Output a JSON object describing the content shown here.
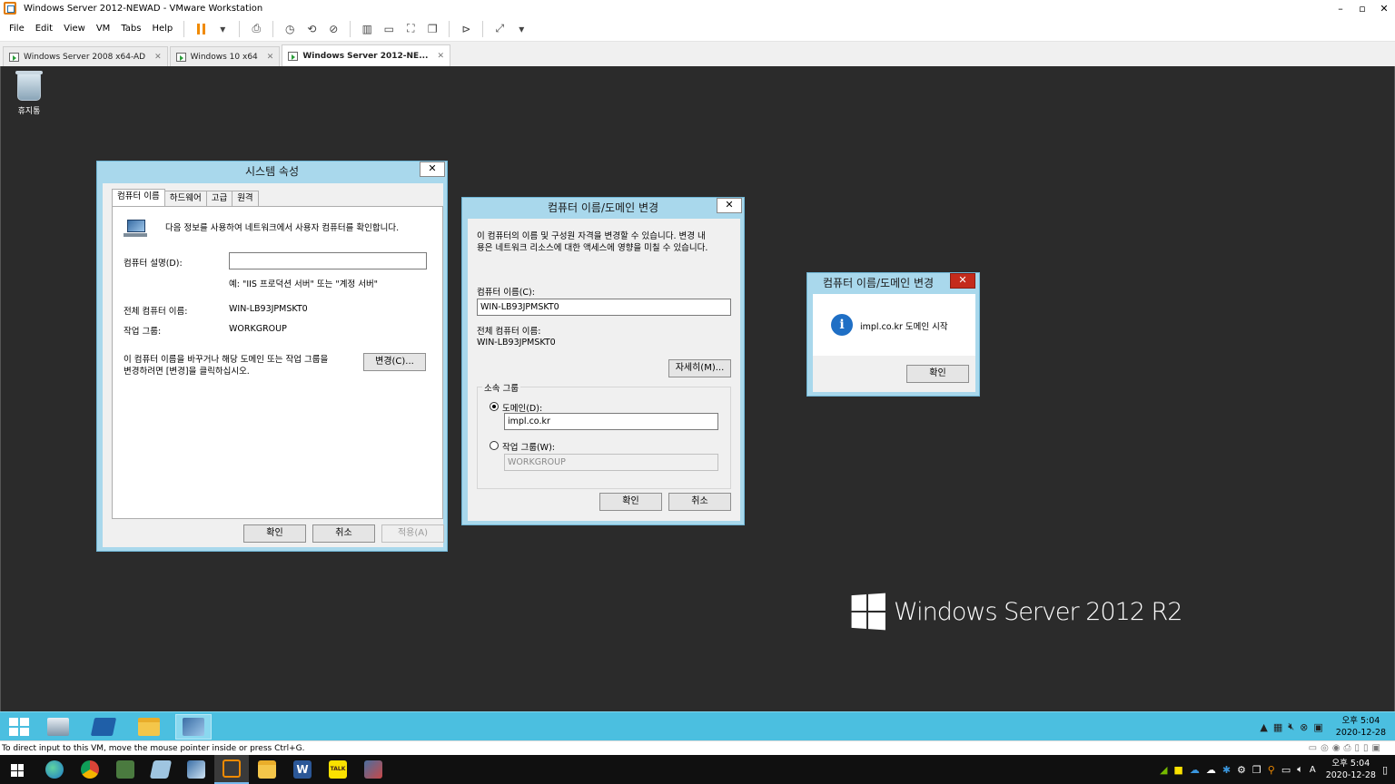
{
  "window": {
    "title": "Windows Server 2012-NEWAD - VMware Workstation",
    "controls": [
      "–",
      "▫",
      "✕"
    ]
  },
  "menu": {
    "items": [
      "File",
      "Edit",
      "View",
      "VM",
      "Tabs",
      "Help"
    ]
  },
  "vm_tabs": [
    {
      "label": "Windows Server 2008 x64-AD",
      "active": false
    },
    {
      "label": "Windows 10 x64",
      "active": false
    },
    {
      "label": "Windows Server 2012-NE...",
      "active": true
    }
  ],
  "desktop": {
    "recycle_bin_label": "휴지통",
    "branding": "Windows Server 2012 R2"
  },
  "system_properties": {
    "title": "시스템 속성",
    "close": "✕",
    "tabs": [
      "컴퓨터 이름",
      "하드웨어",
      "고급",
      "원격"
    ],
    "intro": "다음 정보를 사용하여 네트워크에서 사용자 컴퓨터를 확인합니다.",
    "description_label": "컴퓨터 설명(D):",
    "description_value": "",
    "example": "예: \"IIS 프로덕션 서버\" 또는 \"계정 서버\"",
    "full_name_label": "전체 컴퓨터 이름:",
    "full_name_value": "WIN-LB93JPMSKT0",
    "workgroup_label": "작업 그룹:",
    "workgroup_value": "WORKGROUP",
    "rename_line1": "이 컴퓨터 이름을 바꾸거나 해당 도메인 또는 작업 그룹을",
    "rename_line2": "변경하려면 [변경]을 클릭하십시오.",
    "change_button": "변경(C)...",
    "ok_button": "확인",
    "cancel_button": "취소",
    "apply_button": "적용(A)"
  },
  "name_change": {
    "title": "컴퓨터 이름/도메인 변경",
    "close": "✕",
    "intro_line1": "이 컴퓨터의 이름 및 구성원 자격을 변경할 수 있습니다. 변경 내",
    "intro_line2": "용은 네트워크 리소스에 대한 액세스에 영향을 미칠 수 있습니다.",
    "computer_name_label": "컴퓨터 이름(C):",
    "computer_name_value": "WIN-LB93JPMSKT0",
    "full_name_label": "전체 컴퓨터 이름:",
    "full_name_value": "WIN-LB93JPMSKT0",
    "more_button": "자세히(M)...",
    "member_of_label": "소속 그룹",
    "domain_label": "도메인(D):",
    "domain_value": "impl.co.kr",
    "workgroup_label": "작업 그룹(W):",
    "workgroup_value": "WORKGROUP",
    "ok_button": "확인",
    "cancel_button": "취소"
  },
  "message_box": {
    "title": "컴퓨터 이름/도메인 변경",
    "close": "✕",
    "icon": "i",
    "message": "impl.co.kr 도메인 시작",
    "ok_button": "확인"
  },
  "guest_taskbar": {
    "apps": [
      "server-manager",
      "powershell",
      "file-explorer",
      "system-properties"
    ],
    "time": "오후 5:04",
    "date": "2020-12-28"
  },
  "status_bar": {
    "text": "To direct input to this VM, move the mouse pointer inside or press Ctrl+G."
  },
  "host_taskbar": {
    "apps": [
      "edge",
      "chrome",
      "vmware-tool",
      "powershell",
      "system-tool",
      "vmware-workstation",
      "file-explorer",
      "word",
      "kakaotalk",
      "remote-tool"
    ],
    "word_label": "W",
    "kakao_label": "TALK",
    "input_indicator": "A",
    "time": "오후 5:04",
    "date": "2020-12-28"
  },
  "colors": {
    "dialog_frame": "#a9d8ec",
    "guest_desktop": "#2b2b2b",
    "guest_taskbar": "#4bbfe0",
    "close_red": "#c42b1c",
    "info_blue": "#1f6fc5"
  }
}
